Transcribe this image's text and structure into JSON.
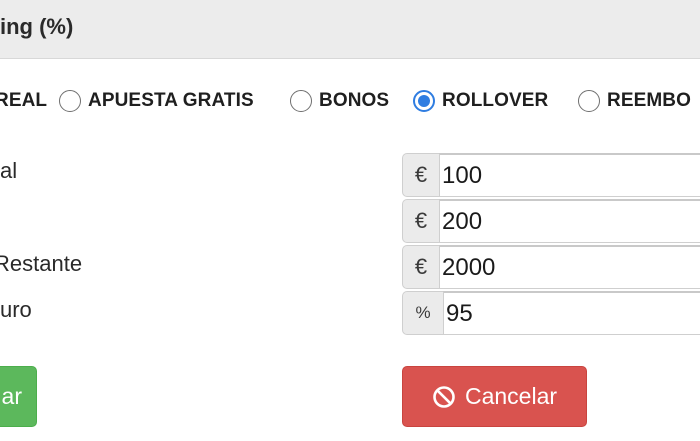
{
  "header": {
    "title": "ing (%)"
  },
  "bet_types": [
    {
      "label": "REAL",
      "checked": false
    },
    {
      "label": "APUESTA GRATIS",
      "checked": false
    },
    {
      "label": "BONOS",
      "checked": false
    },
    {
      "label": "ROLLOVER",
      "checked": true
    },
    {
      "label": "REEMBO",
      "checked": false
    }
  ],
  "fields": [
    {
      "label": "al",
      "addon": "€",
      "value": "100"
    },
    {
      "label": "",
      "addon": "€",
      "value": "200"
    },
    {
      "label": "Restante",
      "addon": "€",
      "value": "2000"
    },
    {
      "label": "uro",
      "addon": "%",
      "value": "95"
    }
  ],
  "buttons": {
    "confirm_label": "ar",
    "cancel_label": "Cancelar",
    "cancel_icon": "ban-icon"
  },
  "colors": {
    "radio_checked": "#2f7de1",
    "confirm_button": "#5cb85c",
    "cancel_button": "#d9534f"
  }
}
